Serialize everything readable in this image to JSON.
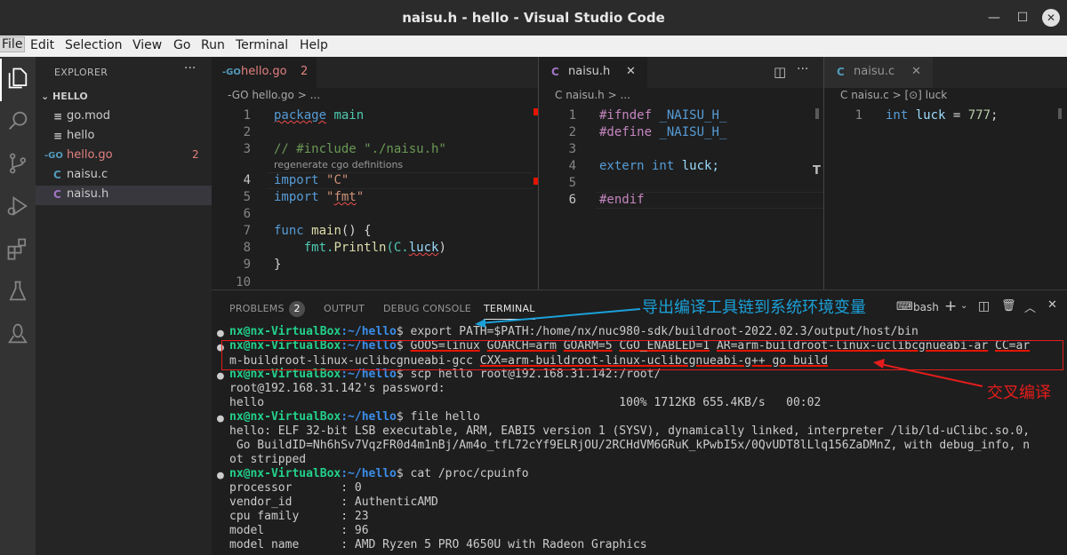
{
  "window": {
    "title": "naisu.h - hello - Visual Studio Code",
    "minimize": "—",
    "maximize": "☐",
    "close": "✕"
  },
  "menu": [
    "File",
    "Edit",
    "Selection",
    "View",
    "Go",
    "Run",
    "Terminal",
    "Help"
  ],
  "sidebar": {
    "header": "EXPLORER",
    "more": "···",
    "folder": "HELLO",
    "files": [
      {
        "icon": "≡",
        "name": "go.mod"
      },
      {
        "icon": "≡",
        "name": "hello"
      },
      {
        "icon": "-GO",
        "name": "hello.go",
        "badge": "2"
      },
      {
        "icon": "C",
        "name": "naisu.c"
      },
      {
        "icon": "C",
        "name": "naisu.h"
      }
    ]
  },
  "editor1": {
    "tab": {
      "icon": "-GO",
      "name": "hello.go",
      "badge": "2"
    },
    "breadcrumb": "-GO hello.go > ...",
    "lens": "regenerate cgo definitions",
    "lines": [
      "1",
      "2",
      "3",
      "4",
      "5",
      "6",
      "7",
      "8",
      "9",
      "10"
    ],
    "code": {
      "l1a": "package",
      "l1b": " main",
      "l3": "// #include \"./naisu.h\"",
      "l4a": "import",
      "l4b": "\"C\"",
      "l5a": "import",
      "l5b": "\"",
      "l5c": "fmt",
      "l5d": "\"",
      "l7a": "func",
      "l7b": "main",
      "l7c": "() {",
      "l8a": "    fmt.",
      "l8b": "Println",
      "l8c": "(C.",
      "l8d": "luck",
      "l8e": ")",
      "l9": "}"
    }
  },
  "editor2": {
    "tab": {
      "icon": "C",
      "name": "naisu.h",
      "close": "✕"
    },
    "breadcrumb": "C naisu.h > ...",
    "lines": [
      "1",
      "2",
      "3",
      "4",
      "5",
      "6"
    ],
    "code": {
      "l1a": "#ifndef",
      "l1b": " _NAISU_H_",
      "l2a": "#define",
      "l2b": " _NAISU_H_",
      "l4a": "extern",
      "l4b": " int",
      "l4c": " luck;",
      "l6": "#endif"
    }
  },
  "editor3": {
    "tab": {
      "icon": "C",
      "name": "naisu.c",
      "close": "✕"
    },
    "breadcrumb": "C naisu.c > [⊙] luck",
    "lines": [
      "1"
    ],
    "code": {
      "l1a": "int",
      "l1b": " luck",
      "l1c": " = ",
      "l1d": "777",
      "l1e": ";"
    }
  },
  "panel": {
    "tabs": [
      "PROBLEMS",
      "OUTPUT",
      "DEBUG CONSOLE",
      "TERMINAL"
    ],
    "problems_count": "2",
    "shell": "bash",
    "terminal": {
      "prompt_user": "nx@nx-VirtualBox",
      "prompt_path": ":~/hello",
      "cmd1": "$ export PATH=$PATH:/home/nx/nuc980-sdk/buildroot-2022.02.3/output/host/bin",
      "cmd2a": "$ ",
      "cmd2_goos": "GOOS=linux",
      "cmd2_goarch": "GOARCH=arm",
      "cmd2_goarm": "GOARM=5",
      "cmd2_cgo": "CGO_ENABLED=1",
      "cmd2_ar": "AR=arm-buildroot-linux-uclibcgnueabi-ar",
      "cmd2_cc": "CC=ar",
      "cmd2_line2a": "m-buildroot-linux-uclibcgnueabi-gcc ",
      "cmd2_cxx": "CXX=arm-buildroot-linux-uclibcgnueabi-g++",
      "cmd2_go": " go build",
      "cmd3": "$ scp hello root@192.168.31.142:/root/",
      "out_pw": "root@192.168.31.142's password:",
      "out_hello": "hello                                                   100% 1712KB 655.4KB/s   00:02",
      "cmd4": "$ file hello",
      "out_file1": "hello: ELF 32-bit LSB executable, ARM, EABI5 version 1 (SYSV), dynamically linked, interpreter /lib/ld-uClibc.so.0,",
      "out_file2": " Go BuildID=Nh6hSv7VqzFR0d4m1nBj/Am4o_tfL72cYf9ELRjOU/2RCHdVM6GRuK_kPwbI5x/0QvUDT8lLlq156ZaDMnZ, with debug_info, n",
      "out_file3": "ot stripped",
      "cmd5": "$ cat /proc/cpuinfo",
      "cpu1": "processor       : 0",
      "cpu2": "vendor_id       : AuthenticAMD",
      "cpu3": "cpu family      : 23",
      "cpu4": "model           : 96",
      "cpu5": "model name      : AMD Ryzen 5 PRO 4650U with Radeon Graphics"
    }
  },
  "annotations": {
    "export": "导出编译工具链到系统环境变量",
    "cross": "交叉编译"
  },
  "colors": {
    "prompt": "#23d18b",
    "path": "#3b8eea",
    "annotation_blue": "#1ba0d8",
    "annotation_red": "#e51c1c"
  }
}
